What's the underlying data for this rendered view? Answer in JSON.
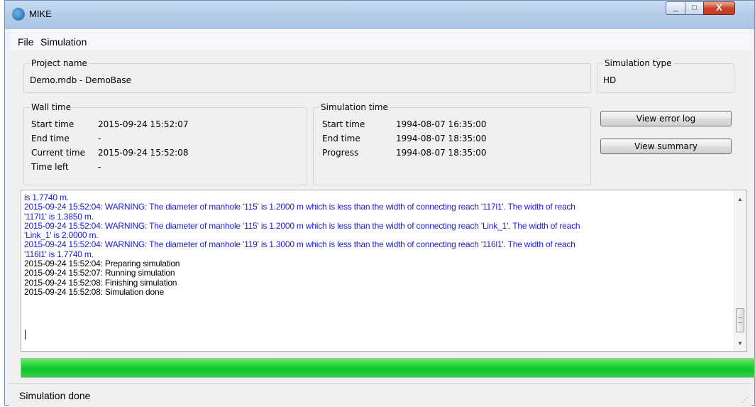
{
  "window": {
    "title": "MIKE",
    "min": "_",
    "max": "□",
    "close": "X"
  },
  "menu": {
    "file": "File",
    "simulation": "Simulation"
  },
  "project": {
    "label": "Project name",
    "value": "Demo.mdb - DemoBase"
  },
  "sim_type": {
    "label": "Simulation type",
    "value": "HD"
  },
  "wall_time": {
    "label": "Wall time",
    "rows": [
      {
        "label": "Start time",
        "value": "2015-09-24 15:52:07"
      },
      {
        "label": "End time",
        "value": "-"
      },
      {
        "label": "Current time",
        "value": "2015-09-24 15:52:08"
      },
      {
        "label": "Time left",
        "value": "-"
      }
    ]
  },
  "sim_time": {
    "label": "Simulation time",
    "rows": [
      {
        "label": "Start time",
        "value": "1994-08-07 16:35:00"
      },
      {
        "label": "End time",
        "value": "1994-08-07 18:35:00"
      },
      {
        "label": "Progress",
        "value": "1994-08-07 18:35:00"
      }
    ]
  },
  "buttons": {
    "error_log": "View error log",
    "summary": "View summary"
  },
  "log": {
    "lines": [
      {
        "text": "is 1.7740 m.",
        "type": "warn"
      },
      {
        "text": "2015-09-24 15:52:04: WARNING: The diameter of manhole '115' is 1.2000 m which is less than the width of connecting reach '117l1'. The width of reach",
        "type": "warn"
      },
      {
        "text": "'117l1' is 1.3850 m.",
        "type": "warn"
      },
      {
        "text": "2015-09-24 15:52:04: WARNING: The diameter of manhole '115' is 1.2000 m which is less than the width of connecting reach 'Link_1'. The width of reach",
        "type": "warn"
      },
      {
        "text": "'Link_1' is 2.0000 m.",
        "type": "warn"
      },
      {
        "text": "2015-09-24 15:52:04: WARNING: The diameter of manhole '119' is 1.3000 m which is less than the width of connecting reach '116l1'. The width of reach",
        "type": "warn"
      },
      {
        "text": "'116l1' is 1.7740 m.",
        "type": "warn"
      },
      {
        "text": "2015-09-24 15:52:04: Preparing simulation",
        "type": "info"
      },
      {
        "text": "2015-09-24 15:52:07: Running simulation",
        "type": "info"
      },
      {
        "text": "2015-09-24 15:52:08: Finishing simulation",
        "type": "info"
      },
      {
        "text": "2015-09-24 15:52:08: Simulation done",
        "type": "info"
      }
    ]
  },
  "progress": {
    "percent": 100,
    "color": "#1fd23a"
  },
  "status": {
    "text": "Simulation done"
  },
  "icons": {
    "app": "mike-app-icon",
    "scroll_up": "up-arrow-icon",
    "scroll_down": "down-arrow-icon",
    "grip": "resize-grip-icon"
  }
}
